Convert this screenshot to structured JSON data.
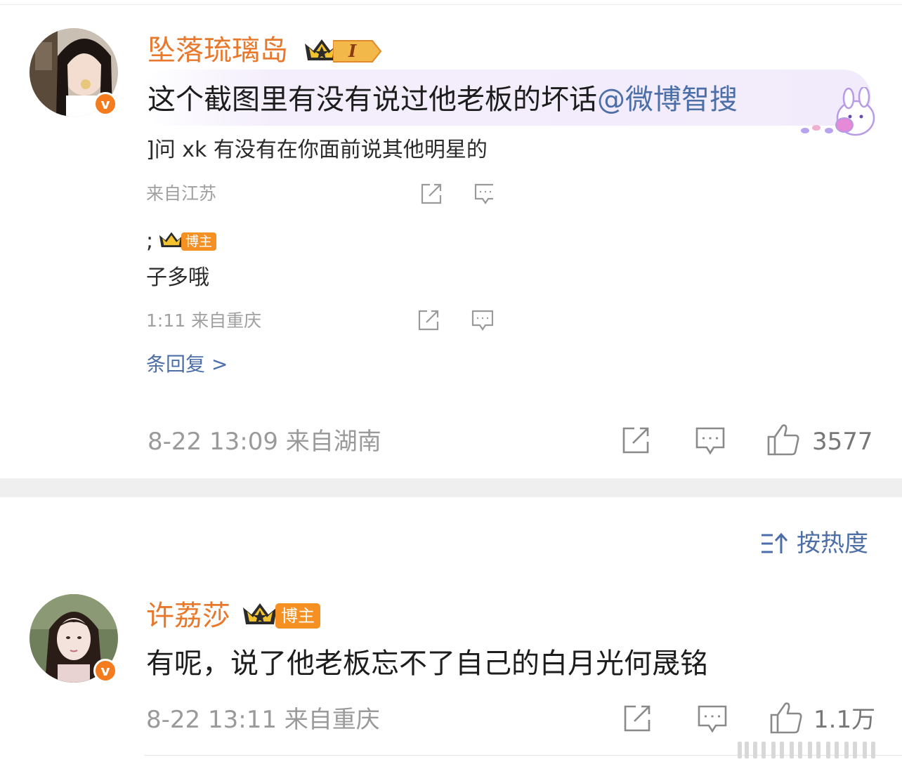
{
  "comment1": {
    "username": "坠落琉璃岛",
    "level_badge": "I",
    "verified_badge": "v",
    "text": "这个截图里有没有说过他老板的坏话",
    "mention": "@微博智搜",
    "embedded_screenshot": {
      "reply_a_text": "]问 xk 有没有在你面前说其他明星的",
      "reply_a_meta": "来自江苏",
      "reply_b_user_fragment": ";",
      "reply_b_badge": "博主",
      "reply_b_text": "子多哦",
      "reply_b_meta": "1:11  来自重庆",
      "more_replies": "条回复 >"
    },
    "meta": "8-22 13:09  来自湖南",
    "likes": "3577"
  },
  "sort": {
    "label": "按热度"
  },
  "comment2": {
    "username": "许荔莎",
    "badge": "博主",
    "verified_badge": "v",
    "text": "有呢，说了他老板忘不了自己的白月光何晟铭",
    "meta": "8-22 13:11  来自重庆",
    "likes": "1.1万"
  },
  "icons": {
    "share": "share-icon",
    "comment": "comment-icon",
    "like": "thumbs-up-icon",
    "sort": "sort-icon",
    "crown": "crown-icon"
  },
  "colors": {
    "username": "#e8792c",
    "link": "#4d6fa8",
    "verified": "#f57b1f",
    "blogger_tag": "#f59023"
  }
}
